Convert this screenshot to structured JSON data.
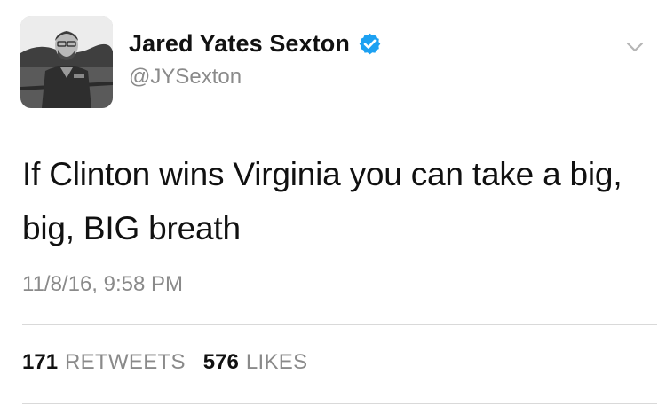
{
  "author": {
    "display_name": "Jared Yates Sexton",
    "handle": "@JYSexton",
    "verified": true,
    "avatar_icon": "profile-photo"
  },
  "tweet": {
    "text": "If Clinton wins Virginia you can take a big, big, BIG breath",
    "timestamp": "11/8/16, 9:58 PM"
  },
  "stats": {
    "retweets_count": "171",
    "retweets_label": "RETWEETS",
    "likes_count": "576",
    "likes_label": "LIKES"
  },
  "icons": {
    "verified": "verified-badge-icon",
    "menu": "chevron-down-icon"
  },
  "colors": {
    "verified_badge": "#1da1f2",
    "secondary_text": "#8a8a8a",
    "primary_text": "#111111",
    "divider": "#d9d9d9"
  }
}
